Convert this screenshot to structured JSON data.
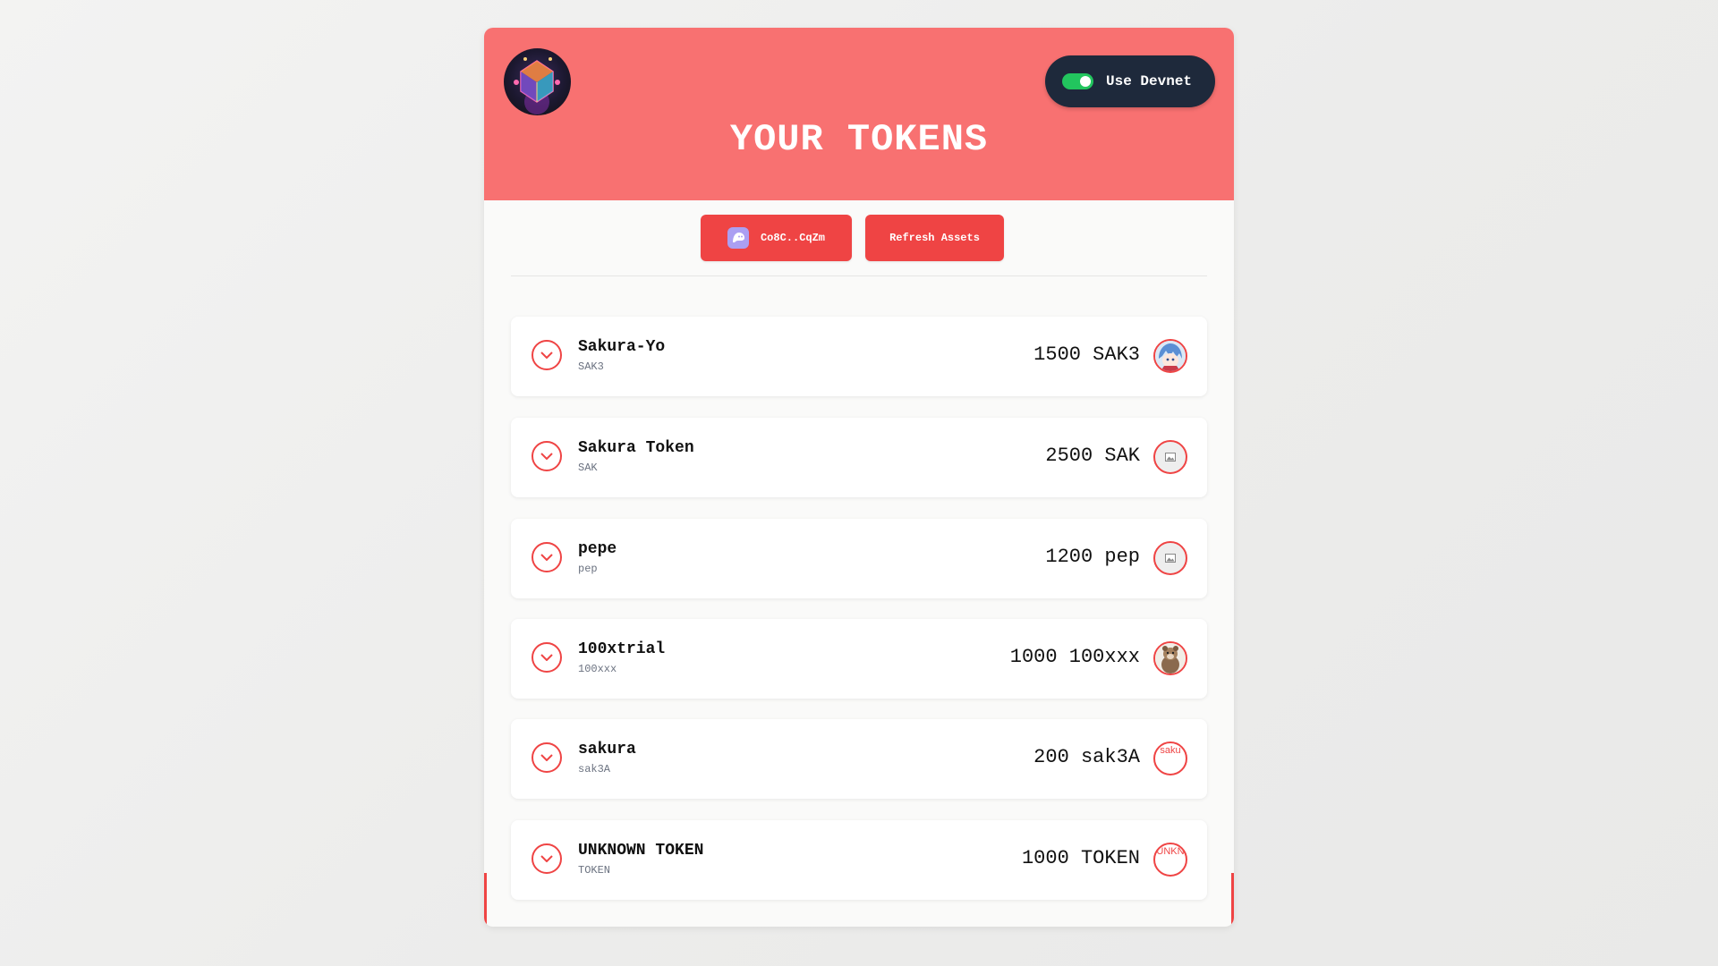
{
  "header": {
    "title": "YOUR TOKENS",
    "devnet_label": "Use Devnet",
    "devnet_enabled": true,
    "color": "#f87171"
  },
  "actions": {
    "wallet_label": "Co8C..CqZm",
    "refresh_label": "Refresh Assets",
    "accent_color": "#ef4444"
  },
  "tokens": [
    {
      "name": "Sakura-Yo",
      "symbol": "SAK3",
      "balance": "1500 SAK3",
      "icon": "anime-avatar-icon"
    },
    {
      "name": "Sakura Token",
      "symbol": "SAK",
      "balance": "2500 SAK",
      "icon": "image-placeholder-icon"
    },
    {
      "name": "pepe",
      "symbol": "pep",
      "balance": "1200 pep",
      "icon": "image-placeholder-icon"
    },
    {
      "name": "100xtrial",
      "symbol": "100xxx",
      "balance": "1000 100xxx",
      "icon": "animal-avatar-icon"
    },
    {
      "name": "sakura",
      "symbol": "sak3A",
      "balance": "200 sak3A",
      "icon": "broken-image-icon",
      "alt": "saku"
    },
    {
      "name": "UNKNOWN TOKEN",
      "symbol": "TOKEN",
      "balance": "1000 TOKEN",
      "icon": "broken-image-icon",
      "alt": "UNKN"
    }
  ]
}
